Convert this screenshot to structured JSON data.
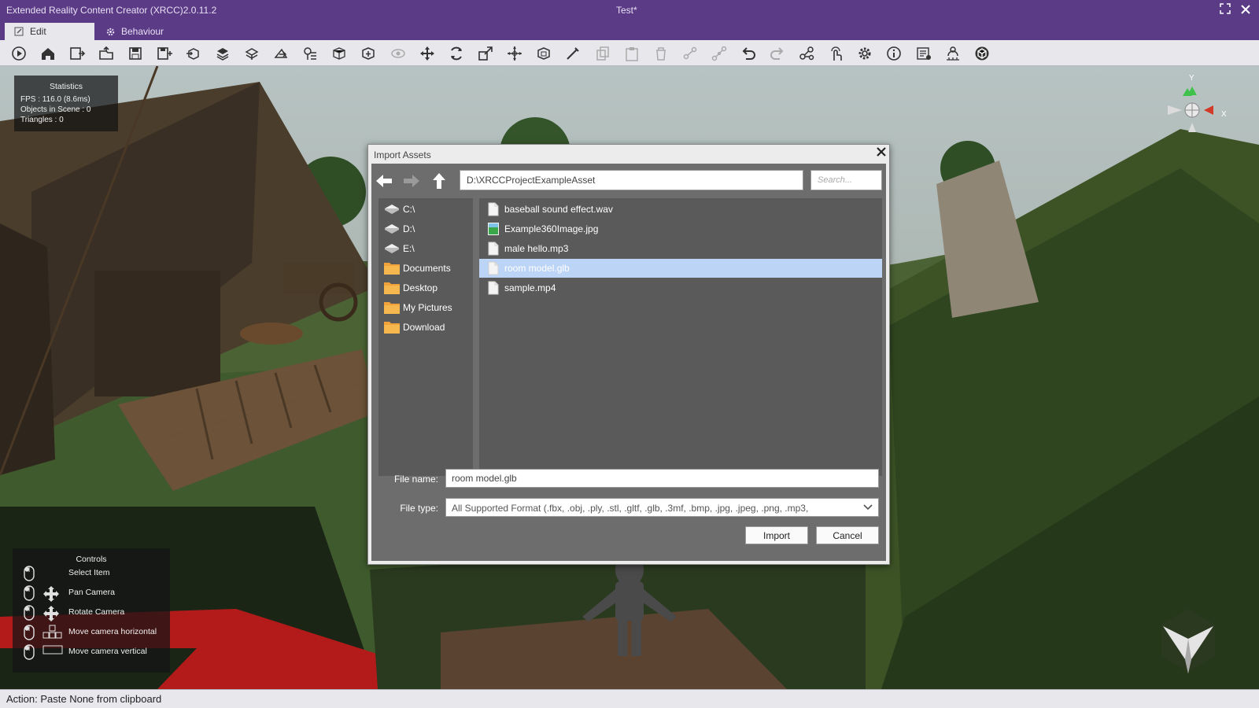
{
  "window": {
    "app_title": "Extended Reality Content Creator (XRCC)2.0.11.2",
    "document_title": "Test*"
  },
  "tabs": [
    {
      "label": "Edit",
      "icon": "edit-icon",
      "active": true
    },
    {
      "label": "Behaviour",
      "icon": "gear-icon",
      "active": false
    }
  ],
  "toolbar": {
    "buttons": [
      "play",
      "home",
      "new-scene",
      "open-scene",
      "save",
      "save-as",
      "import-model",
      "shapes",
      "terrain",
      "export",
      "animation-list",
      "cube-outline",
      "add-box",
      "visibility",
      "move",
      "rotate",
      "scale",
      "pivot",
      "bounds",
      "pick",
      "copy",
      "paste",
      "delete",
      "unlink",
      "link",
      "undo",
      "redo",
      "graph",
      "touch",
      "settings",
      "info",
      "script-list",
      "person-network",
      "unity"
    ]
  },
  "statistics": {
    "title": "Statistics",
    "fps": "FPS : 116.0 (8.6ms)",
    "objects": "Objects in Scene : 0",
    "triangles": "Triangles : 0"
  },
  "gizmo": {
    "x_label": "X",
    "y_label": "Y"
  },
  "controls": {
    "title": "Controls",
    "items": [
      {
        "label": "Select Item",
        "icon": "mouse-left-icon"
      },
      {
        "label": "Pan Camera",
        "icon": "move-arrows-icon"
      },
      {
        "label": "Rotate Camera",
        "icon": "move-arrows-icon"
      },
      {
        "label": "Move camera horizontal",
        "icon": "wasd-keys-icon"
      },
      {
        "label": "Move camera vertical",
        "icon": "spacebar-icon"
      }
    ]
  },
  "dialog": {
    "title": "Import Assets",
    "path": "D:\\XRCCProjectExampleAsset",
    "search_placeholder": "Search...",
    "sidebar": [
      {
        "label": "C:\\",
        "icon": "drive-icon"
      },
      {
        "label": "D:\\",
        "icon": "drive-icon"
      },
      {
        "label": "E:\\",
        "icon": "drive-icon"
      },
      {
        "label": "Documents",
        "icon": "folder-icon"
      },
      {
        "label": "Desktop",
        "icon": "folder-icon"
      },
      {
        "label": "My Pictures",
        "icon": "folder-icon"
      },
      {
        "label": "Download",
        "icon": "folder-icon"
      }
    ],
    "files": [
      {
        "name": "baseball sound effect.wav",
        "icon": "file-icon",
        "selected": false
      },
      {
        "name": "Example360Image.jpg",
        "icon": "image-file-icon",
        "selected": false
      },
      {
        "name": "male hello.mp3",
        "icon": "file-icon",
        "selected": false
      },
      {
        "name": "room model.glb",
        "icon": "file-icon",
        "selected": true
      },
      {
        "name": "sample.mp4",
        "icon": "file-icon",
        "selected": false
      }
    ],
    "file_name_label": "File name:",
    "file_name_value": "room model.glb",
    "file_type_label": "File type:",
    "file_type_value": "All Supported Format (.fbx, .obj, .ply, .stl, .gltf, .glb, .3mf, .bmp, .jpg, .jpeg, .png, .mp3,",
    "import_label": "Import",
    "cancel_label": "Cancel"
  },
  "status": {
    "text": "Action: Paste None from clipboard"
  },
  "colors": {
    "titlebar": "#5b3b86",
    "toolbar": "#e8e8ec",
    "selection": "#bcd4f6"
  }
}
